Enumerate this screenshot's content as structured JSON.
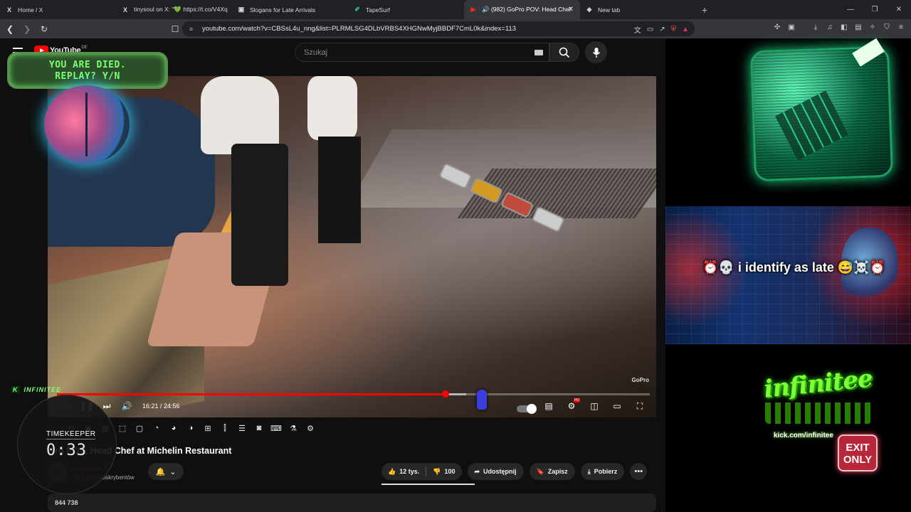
{
  "browser": {
    "tabs": [
      {
        "favicon": "X",
        "label": "Home / X"
      },
      {
        "favicon": "X",
        "label": "tinysoul on X: \"💚 https://t.co/V4Xq"
      },
      {
        "favicon": "▣",
        "label": "Slogans for Late Arrivals"
      },
      {
        "favicon": "✐",
        "label": "TapeSurf"
      },
      {
        "favicon": "▶",
        "label": "🔊 (982) GoPro POV: Head Chef",
        "active": true
      },
      {
        "favicon": "◈",
        "label": "New tab"
      }
    ],
    "url": "youtube.com/watch?v=CBSsL4u_nng&list=PLRMLSG4DLbVRBS4XHGNwMyjBBDF7CmL0k&index=113"
  },
  "youtube": {
    "logo_text": "YouTube",
    "region": "DE",
    "search_placeholder": "Szukaj"
  },
  "player": {
    "time_display": "16:21 / 24:56",
    "progress_fraction": 0.655,
    "buffer_fraction": 0.69,
    "watermark": "GoPro"
  },
  "video": {
    "title": "GoPro POV: Head Chef at Michelin Restaurant",
    "title_visible": "...ro POV: Head Chef at Michelin Restaurant",
    "subscribers": "11,1 mln subskrybentów",
    "views": "844 738"
  },
  "actions": {
    "likes": "12 tys.",
    "dislikes": "100",
    "share": "Udostępnij",
    "save": "Zapisz",
    "download": "Pobierz"
  },
  "overlay": {
    "died_line1": "YOU ARE DIED.",
    "died_line2": "REPLAY? Y/N",
    "badge": "INFINITEE",
    "timekeeper_label": "TIMEKEEPER",
    "timekeeper_time": "0:33"
  },
  "side": {
    "banner_text": "⏰💀 i identify as late 😅☠️⏰",
    "logo": "infinitee",
    "kick_url": "kick.com/infinitee",
    "exit_line1": "EXIT",
    "exit_line2": "ONLY"
  },
  "colors": {
    "accent_red": "#ff0000",
    "neon_green": "#7dff73",
    "page_bg": "#0f0f0f"
  }
}
